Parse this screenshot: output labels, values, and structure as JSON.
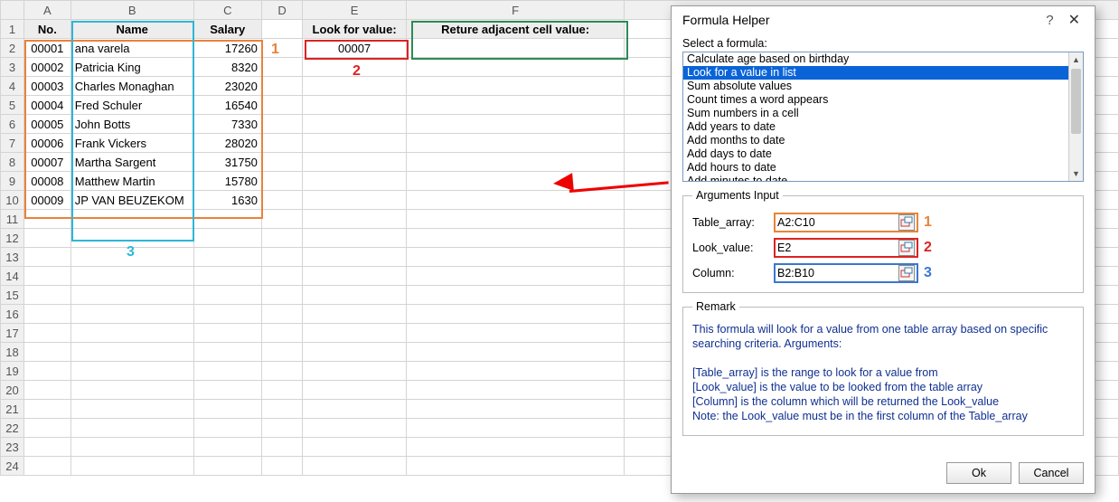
{
  "columns": [
    "A",
    "B",
    "C",
    "D",
    "E",
    "F"
  ],
  "rows": [
    1,
    2,
    3,
    4,
    5,
    6,
    7,
    8,
    9,
    10,
    11,
    12,
    13,
    14,
    15,
    16,
    17,
    18,
    19,
    20,
    21,
    22,
    23,
    24
  ],
  "header": {
    "no": "No.",
    "name": "Name",
    "salary": "Salary"
  },
  "look_for_label": "Look for value:",
  "return_label": "Reture adjacent cell value:",
  "look_for_value": "00007",
  "data_rows": [
    {
      "no": "00001",
      "name": "ana varela",
      "salary": "17260"
    },
    {
      "no": "00002",
      "name": "Patricia King",
      "salary": "8320"
    },
    {
      "no": "00003",
      "name": "Charles Monaghan",
      "salary": "23020"
    },
    {
      "no": "00004",
      "name": "Fred Schuler",
      "salary": "16540"
    },
    {
      "no": "00005",
      "name": "John Botts",
      "salary": "7330"
    },
    {
      "no": "00006",
      "name": "Frank Vickers",
      "salary": "28020"
    },
    {
      "no": "00007",
      "name": "Martha Sargent",
      "salary": "31750"
    },
    {
      "no": "00008",
      "name": "Matthew Martin",
      "salary": "15780"
    },
    {
      "no": "00009",
      "name": "JP VAN BEUZEKOM",
      "salary": "1630"
    }
  ],
  "anno": {
    "a1": "1",
    "a2": "2",
    "a3": "3"
  },
  "dialog": {
    "title": "Formula Helper",
    "help": "?",
    "close": "✕",
    "select_label": "Select a formula:",
    "formulas": [
      "Calculate age based on birthday",
      "Look for a value in list",
      "Sum absolute values",
      "Count times a word appears",
      "Sum numbers in a cell",
      "Add years to date",
      "Add months to date",
      "Add days to date",
      "Add hours to date",
      "Add minutes to date"
    ],
    "selected_index": 1,
    "args_legend": "Arguments Input",
    "args": [
      {
        "label": "Table_array:",
        "value": "A2:C10",
        "cls": "af-orange",
        "num": "1",
        "numcls": "c-orange"
      },
      {
        "label": "Look_value:",
        "value": "E2",
        "cls": "af-red",
        "num": "2",
        "numcls": "c-red"
      },
      {
        "label": "Column:",
        "value": "B2:B10",
        "cls": "af-blue",
        "num": "3",
        "numcls": "c-blue"
      }
    ],
    "remark_legend": "Remark",
    "remark_lines": [
      "This formula will look for a value from one table array based on specific searching criteria. Arguments:",
      "",
      "[Table_array] is the range to look for a value from",
      "[Look_value] is the value to be looked from the table array",
      "[Column] is the column which will be returned the Look_value",
      "Note: the Look_value must be in the first column of the Table_array"
    ],
    "ok": "Ok",
    "cancel": "Cancel"
  }
}
